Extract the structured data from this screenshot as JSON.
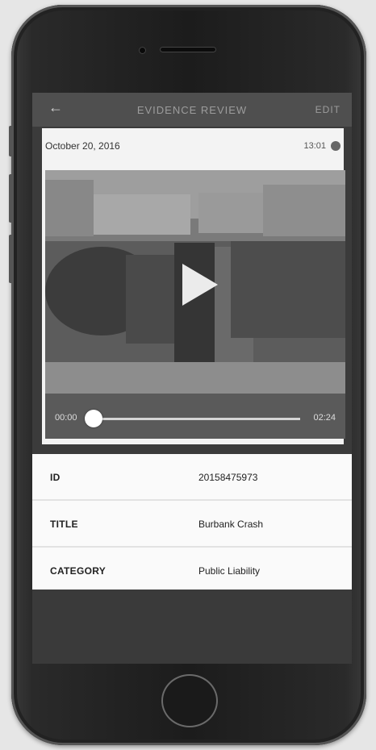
{
  "navbar": {
    "back_icon": "back-arrow-icon",
    "title": "EVIDENCE REVIEW",
    "edit_label": "EDIT"
  },
  "evidence": {
    "date": "October 20, 2016",
    "time": "13:01",
    "video": {
      "start_time": "00:00",
      "end_time": "02:24",
      "progress": 0.0
    }
  },
  "details": [
    {
      "label": "ID",
      "value": "20158475973"
    },
    {
      "label": "TITLE",
      "value": "Burbank Crash"
    },
    {
      "label": "CATEGORY",
      "value": "Public Liability"
    }
  ]
}
